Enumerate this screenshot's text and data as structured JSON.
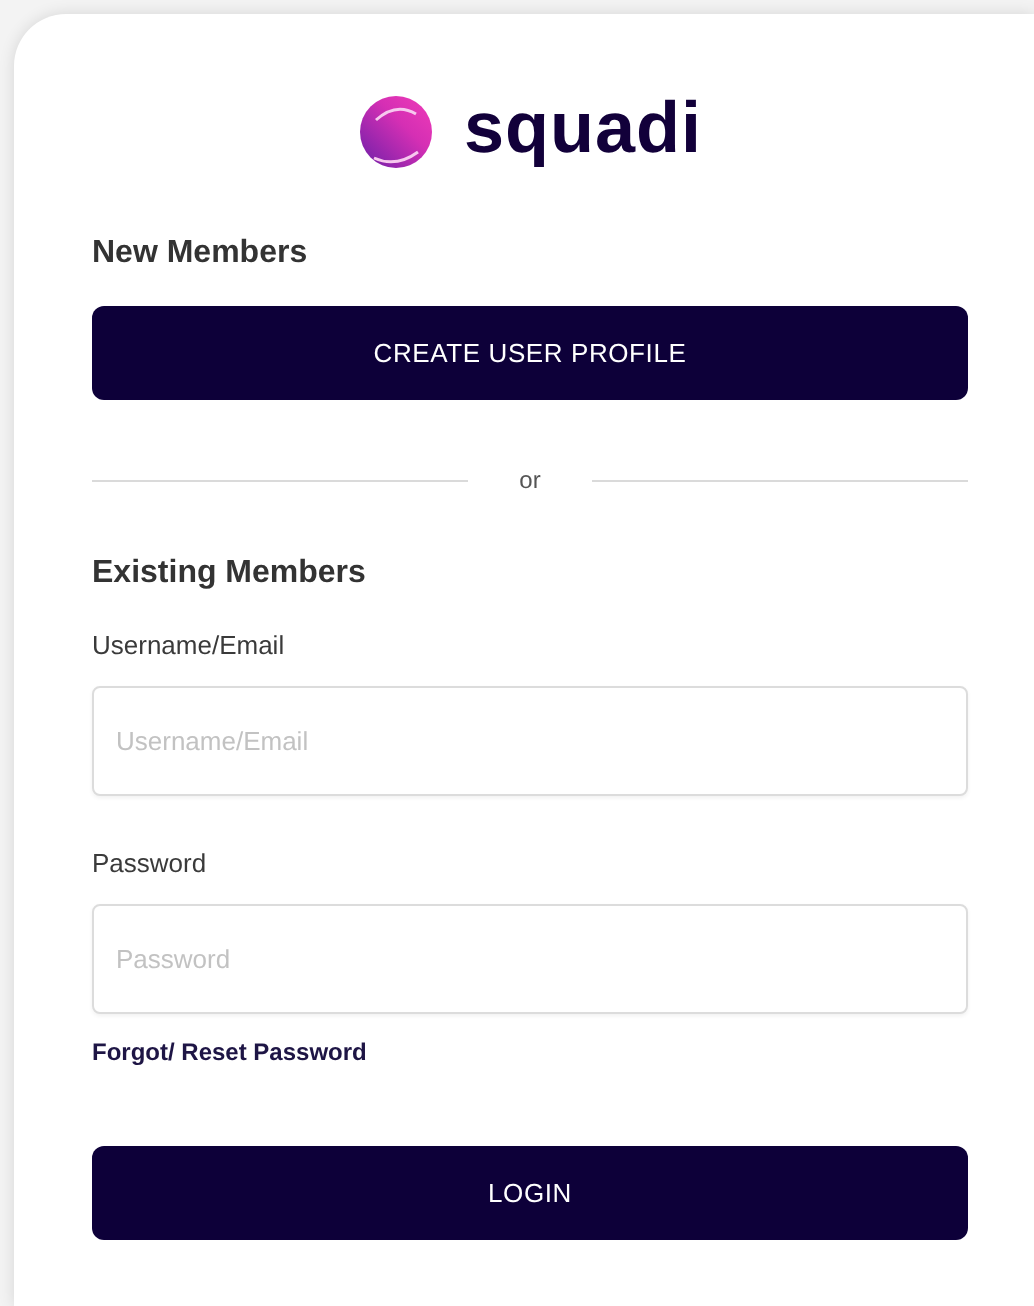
{
  "logo": {
    "text": "squadi"
  },
  "new_members": {
    "heading": "New Members",
    "button": "CREATE USER PROFILE"
  },
  "divider": {
    "text": "or"
  },
  "existing_members": {
    "heading": "Existing Members",
    "fields": [
      {
        "label": "Username/Email",
        "placeholder": "Username/Email"
      },
      {
        "label": "Password",
        "placeholder": "Password"
      }
    ],
    "forgot_link": "Forgot/ Reset Password",
    "button": "LOGIN"
  }
}
